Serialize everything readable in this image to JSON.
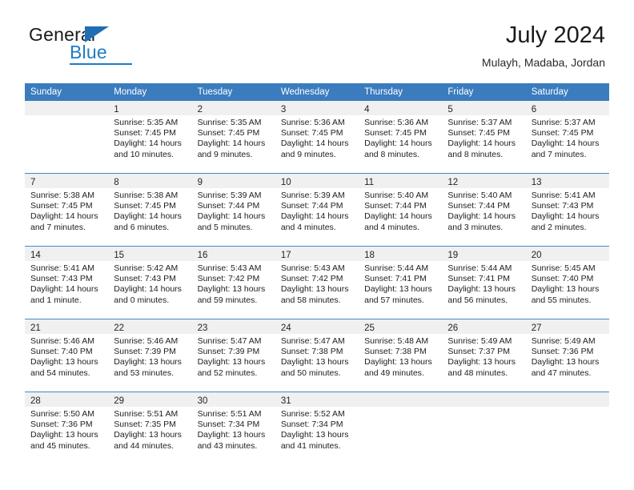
{
  "brand": {
    "name_top": "General",
    "name_bottom": "Blue",
    "accent_color": "#1f7bc4",
    "triangle_color": "#1f6db5"
  },
  "header": {
    "title": "July 2024",
    "subtitle": "Mulayh, Madaba, Jordan"
  },
  "theme": {
    "header_row_bg": "#3a7cbe",
    "daynum_band_bg": "#f0f0f0",
    "week_divider": "#4a86c2",
    "text": "#1d1d1d"
  },
  "weekdays": [
    "Sunday",
    "Monday",
    "Tuesday",
    "Wednesday",
    "Thursday",
    "Friday",
    "Saturday"
  ],
  "weeks": [
    [
      {
        "day": "",
        "sunrise": "",
        "sunset": "",
        "daylight_1": "",
        "daylight_2": ""
      },
      {
        "day": "1",
        "sunrise": "Sunrise: 5:35 AM",
        "sunset": "Sunset: 7:45 PM",
        "daylight_1": "Daylight: 14 hours",
        "daylight_2": "and 10 minutes."
      },
      {
        "day": "2",
        "sunrise": "Sunrise: 5:35 AM",
        "sunset": "Sunset: 7:45 PM",
        "daylight_1": "Daylight: 14 hours",
        "daylight_2": "and 9 minutes."
      },
      {
        "day": "3",
        "sunrise": "Sunrise: 5:36 AM",
        "sunset": "Sunset: 7:45 PM",
        "daylight_1": "Daylight: 14 hours",
        "daylight_2": "and 9 minutes."
      },
      {
        "day": "4",
        "sunrise": "Sunrise: 5:36 AM",
        "sunset": "Sunset: 7:45 PM",
        "daylight_1": "Daylight: 14 hours",
        "daylight_2": "and 8 minutes."
      },
      {
        "day": "5",
        "sunrise": "Sunrise: 5:37 AM",
        "sunset": "Sunset: 7:45 PM",
        "daylight_1": "Daylight: 14 hours",
        "daylight_2": "and 8 minutes."
      },
      {
        "day": "6",
        "sunrise": "Sunrise: 5:37 AM",
        "sunset": "Sunset: 7:45 PM",
        "daylight_1": "Daylight: 14 hours",
        "daylight_2": "and 7 minutes."
      }
    ],
    [
      {
        "day": "7",
        "sunrise": "Sunrise: 5:38 AM",
        "sunset": "Sunset: 7:45 PM",
        "daylight_1": "Daylight: 14 hours",
        "daylight_2": "and 7 minutes."
      },
      {
        "day": "8",
        "sunrise": "Sunrise: 5:38 AM",
        "sunset": "Sunset: 7:45 PM",
        "daylight_1": "Daylight: 14 hours",
        "daylight_2": "and 6 minutes."
      },
      {
        "day": "9",
        "sunrise": "Sunrise: 5:39 AM",
        "sunset": "Sunset: 7:44 PM",
        "daylight_1": "Daylight: 14 hours",
        "daylight_2": "and 5 minutes."
      },
      {
        "day": "10",
        "sunrise": "Sunrise: 5:39 AM",
        "sunset": "Sunset: 7:44 PM",
        "daylight_1": "Daylight: 14 hours",
        "daylight_2": "and 4 minutes."
      },
      {
        "day": "11",
        "sunrise": "Sunrise: 5:40 AM",
        "sunset": "Sunset: 7:44 PM",
        "daylight_1": "Daylight: 14 hours",
        "daylight_2": "and 4 minutes."
      },
      {
        "day": "12",
        "sunrise": "Sunrise: 5:40 AM",
        "sunset": "Sunset: 7:44 PM",
        "daylight_1": "Daylight: 14 hours",
        "daylight_2": "and 3 minutes."
      },
      {
        "day": "13",
        "sunrise": "Sunrise: 5:41 AM",
        "sunset": "Sunset: 7:43 PM",
        "daylight_1": "Daylight: 14 hours",
        "daylight_2": "and 2 minutes."
      }
    ],
    [
      {
        "day": "14",
        "sunrise": "Sunrise: 5:41 AM",
        "sunset": "Sunset: 7:43 PM",
        "daylight_1": "Daylight: 14 hours",
        "daylight_2": "and 1 minute."
      },
      {
        "day": "15",
        "sunrise": "Sunrise: 5:42 AM",
        "sunset": "Sunset: 7:43 PM",
        "daylight_1": "Daylight: 14 hours",
        "daylight_2": "and 0 minutes."
      },
      {
        "day": "16",
        "sunrise": "Sunrise: 5:43 AM",
        "sunset": "Sunset: 7:42 PM",
        "daylight_1": "Daylight: 13 hours",
        "daylight_2": "and 59 minutes."
      },
      {
        "day": "17",
        "sunrise": "Sunrise: 5:43 AM",
        "sunset": "Sunset: 7:42 PM",
        "daylight_1": "Daylight: 13 hours",
        "daylight_2": "and 58 minutes."
      },
      {
        "day": "18",
        "sunrise": "Sunrise: 5:44 AM",
        "sunset": "Sunset: 7:41 PM",
        "daylight_1": "Daylight: 13 hours",
        "daylight_2": "and 57 minutes."
      },
      {
        "day": "19",
        "sunrise": "Sunrise: 5:44 AM",
        "sunset": "Sunset: 7:41 PM",
        "daylight_1": "Daylight: 13 hours",
        "daylight_2": "and 56 minutes."
      },
      {
        "day": "20",
        "sunrise": "Sunrise: 5:45 AM",
        "sunset": "Sunset: 7:40 PM",
        "daylight_1": "Daylight: 13 hours",
        "daylight_2": "and 55 minutes."
      }
    ],
    [
      {
        "day": "21",
        "sunrise": "Sunrise: 5:46 AM",
        "sunset": "Sunset: 7:40 PM",
        "daylight_1": "Daylight: 13 hours",
        "daylight_2": "and 54 minutes."
      },
      {
        "day": "22",
        "sunrise": "Sunrise: 5:46 AM",
        "sunset": "Sunset: 7:39 PM",
        "daylight_1": "Daylight: 13 hours",
        "daylight_2": "and 53 minutes."
      },
      {
        "day": "23",
        "sunrise": "Sunrise: 5:47 AM",
        "sunset": "Sunset: 7:39 PM",
        "daylight_1": "Daylight: 13 hours",
        "daylight_2": "and 52 minutes."
      },
      {
        "day": "24",
        "sunrise": "Sunrise: 5:47 AM",
        "sunset": "Sunset: 7:38 PM",
        "daylight_1": "Daylight: 13 hours",
        "daylight_2": "and 50 minutes."
      },
      {
        "day": "25",
        "sunrise": "Sunrise: 5:48 AM",
        "sunset": "Sunset: 7:38 PM",
        "daylight_1": "Daylight: 13 hours",
        "daylight_2": "and 49 minutes."
      },
      {
        "day": "26",
        "sunrise": "Sunrise: 5:49 AM",
        "sunset": "Sunset: 7:37 PM",
        "daylight_1": "Daylight: 13 hours",
        "daylight_2": "and 48 minutes."
      },
      {
        "day": "27",
        "sunrise": "Sunrise: 5:49 AM",
        "sunset": "Sunset: 7:36 PM",
        "daylight_1": "Daylight: 13 hours",
        "daylight_2": "and 47 minutes."
      }
    ],
    [
      {
        "day": "28",
        "sunrise": "Sunrise: 5:50 AM",
        "sunset": "Sunset: 7:36 PM",
        "daylight_1": "Daylight: 13 hours",
        "daylight_2": "and 45 minutes."
      },
      {
        "day": "29",
        "sunrise": "Sunrise: 5:51 AM",
        "sunset": "Sunset: 7:35 PM",
        "daylight_1": "Daylight: 13 hours",
        "daylight_2": "and 44 minutes."
      },
      {
        "day": "30",
        "sunrise": "Sunrise: 5:51 AM",
        "sunset": "Sunset: 7:34 PM",
        "daylight_1": "Daylight: 13 hours",
        "daylight_2": "and 43 minutes."
      },
      {
        "day": "31",
        "sunrise": "Sunrise: 5:52 AM",
        "sunset": "Sunset: 7:34 PM",
        "daylight_1": "Daylight: 13 hours",
        "daylight_2": "and 41 minutes."
      },
      {
        "day": "",
        "sunrise": "",
        "sunset": "",
        "daylight_1": "",
        "daylight_2": ""
      },
      {
        "day": "",
        "sunrise": "",
        "sunset": "",
        "daylight_1": "",
        "daylight_2": ""
      },
      {
        "day": "",
        "sunrise": "",
        "sunset": "",
        "daylight_1": "",
        "daylight_2": ""
      }
    ]
  ]
}
